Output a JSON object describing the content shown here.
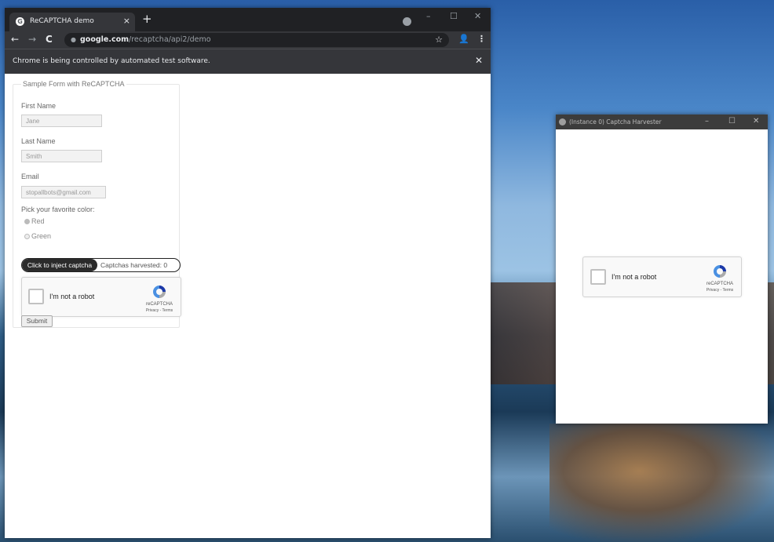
{
  "chrome": {
    "tab_title": "ReCAPTCHA demo",
    "tab_icon": "google-favicon",
    "tab_close": "×",
    "new_tab": "+",
    "window_controls": [
      "–",
      "☐",
      "✕"
    ],
    "nav": {
      "back": "←",
      "forward": "→",
      "reload": "C"
    },
    "url_host": "google.com",
    "url_path": "/recaptcha/api2/demo",
    "infobar_text": "Chrome is being controlled by automated test software.",
    "infobar_close": "✕"
  },
  "form": {
    "legend": "Sample Form with ReCAPTCHA",
    "first_name_label": "First Name",
    "first_name_value": "Jane",
    "last_name_label": "Last Name",
    "last_name_value": "Smith",
    "email_label": "Email",
    "email_value": "stopallbots@gmail.com",
    "color_label": "Pick your favorite color:",
    "color_options": [
      {
        "label": "Red",
        "selected": true
      },
      {
        "label": "Green",
        "selected": false
      }
    ],
    "inject_button": "Click to inject captcha",
    "harvest_count": "Captchas harvested: 0",
    "submit": "Submit"
  },
  "recaptcha": {
    "label": "I'm not a robot",
    "brand": "reCAPTCHA",
    "legal": "Privacy - Terms",
    "checked": false
  },
  "harvester": {
    "title": "(Instance 0) Captcha Harvester",
    "window_controls": [
      "–",
      "☐",
      "✕"
    ]
  },
  "colors": {
    "chrome_dark": "#202124",
    "chrome_toolbar": "#35363a",
    "recaptcha_blue": "#4a90e2"
  }
}
